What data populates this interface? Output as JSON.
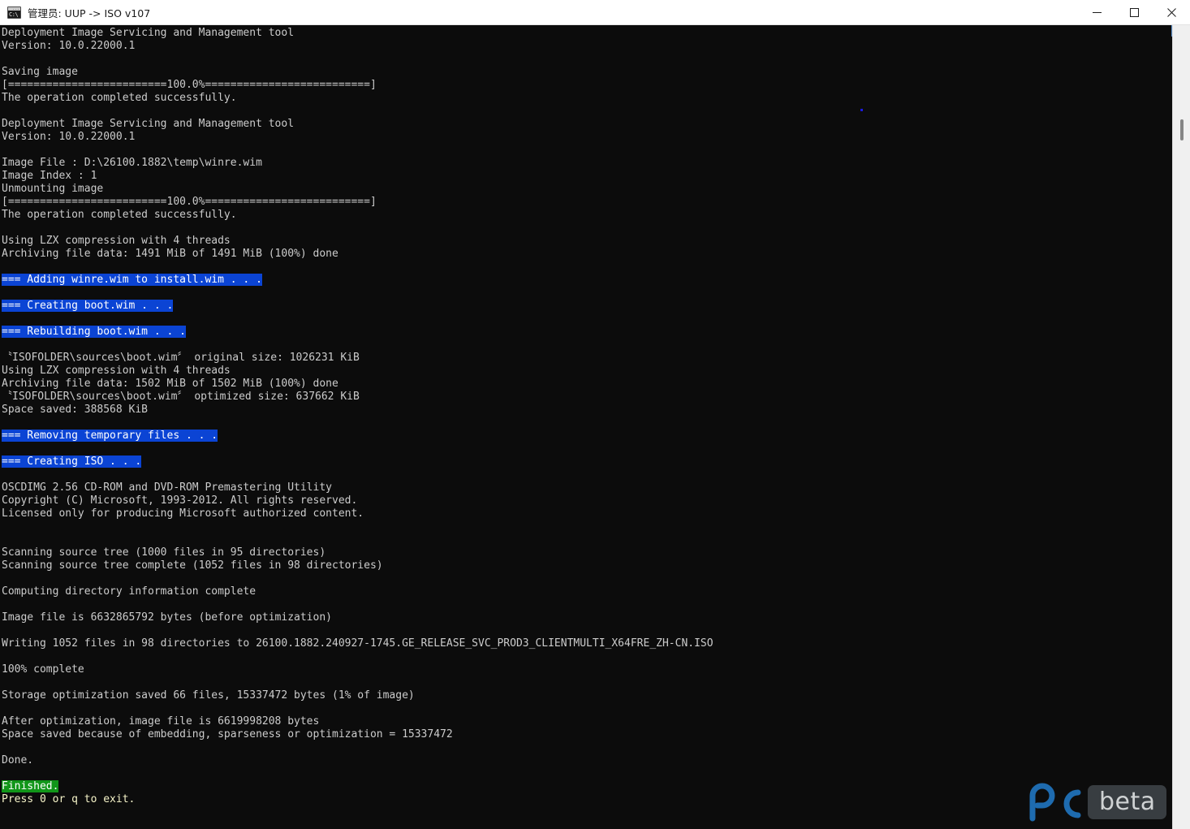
{
  "window": {
    "title": "管理员:  UUP -> ISO v107",
    "icon": "cmd-console-icon",
    "icon_prompt_text": "C:\\",
    "background_color": "#0c0c0c",
    "text_color": "#cccccc",
    "controls": {
      "minimize_label": "—",
      "maximize_label": "□",
      "close_label": "✕"
    }
  },
  "colors": {
    "highlight_blue_bg": "#0b44d4",
    "highlight_green_bg": "#119619",
    "highlight_text": "#ffffff",
    "prompt_yellow": "#f5f3c8",
    "titlebar_bg": "#ffffff",
    "scrollbar_track": "#f0f0f0",
    "scrollbar_thumb": "#858585",
    "watermark_blue": "#1f6fb5",
    "watermark_chip": "#3a3f43"
  },
  "console": {
    "lines": [
      {
        "text": "Deployment Image Servicing and Management tool",
        "style": "normal"
      },
      {
        "text": "Version: 10.0.22000.1",
        "style": "normal"
      },
      {
        "text": "",
        "style": "normal"
      },
      {
        "text": "Saving image",
        "style": "normal"
      },
      {
        "text": "[=========================100.0%==========================]",
        "style": "normal"
      },
      {
        "text": "The operation completed successfully.",
        "style": "normal"
      },
      {
        "text": "",
        "style": "normal"
      },
      {
        "text": "Deployment Image Servicing and Management tool",
        "style": "normal"
      },
      {
        "text": "Version: 10.0.22000.1",
        "style": "normal"
      },
      {
        "text": "",
        "style": "normal"
      },
      {
        "text": "Image File : D:\\26100.1882\\temp\\winre.wim",
        "style": "normal"
      },
      {
        "text": "Image Index : 1",
        "style": "normal"
      },
      {
        "text": "Unmounting image",
        "style": "normal"
      },
      {
        "text": "[=========================100.0%==========================]",
        "style": "normal"
      },
      {
        "text": "The operation completed successfully.",
        "style": "normal"
      },
      {
        "text": "",
        "style": "normal"
      },
      {
        "text": "Using LZX compression with 4 threads",
        "style": "normal"
      },
      {
        "text": "Archiving file data: 1491 MiB of 1491 MiB (100%) done",
        "style": "normal"
      },
      {
        "text": "",
        "style": "normal"
      },
      {
        "text": "=== Adding winre.wim to install.wim . . .",
        "style": "blue"
      },
      {
        "text": "",
        "style": "normal"
      },
      {
        "text": "=== Creating boot.wim . . .",
        "style": "blue"
      },
      {
        "text": "",
        "style": "normal"
      },
      {
        "text": "=== Rebuilding boot.wim . . .",
        "style": "blue"
      },
      {
        "text": "",
        "style": "normal"
      },
      {
        "text": "〝ISOFOLDER\\sources\\boot.wim〞 original size: 1026231 KiB",
        "style": "normal"
      },
      {
        "text": "Using LZX compression with 4 threads",
        "style": "normal"
      },
      {
        "text": "Archiving file data: 1502 MiB of 1502 MiB (100%) done",
        "style": "normal"
      },
      {
        "text": "〝ISOFOLDER\\sources\\boot.wim〞 optimized size: 637662 KiB",
        "style": "normal"
      },
      {
        "text": "Space saved: 388568 KiB",
        "style": "normal"
      },
      {
        "text": "",
        "style": "normal"
      },
      {
        "text": "=== Removing temporary files . . .",
        "style": "blue"
      },
      {
        "text": "",
        "style": "normal"
      },
      {
        "text": "=== Creating ISO . . .",
        "style": "blue"
      },
      {
        "text": "",
        "style": "normal"
      },
      {
        "text": "OSCDIMG 2.56 CD-ROM and DVD-ROM Premastering Utility",
        "style": "normal"
      },
      {
        "text": "Copyright (C) Microsoft, 1993-2012. All rights reserved.",
        "style": "normal"
      },
      {
        "text": "Licensed only for producing Microsoft authorized content.",
        "style": "normal"
      },
      {
        "text": "",
        "style": "normal"
      },
      {
        "text": "",
        "style": "normal"
      },
      {
        "text": "Scanning source tree (1000 files in 95 directories)",
        "style": "normal"
      },
      {
        "text": "Scanning source tree complete (1052 files in 98 directories)",
        "style": "normal"
      },
      {
        "text": "",
        "style": "normal"
      },
      {
        "text": "Computing directory information complete",
        "style": "normal"
      },
      {
        "text": "",
        "style": "normal"
      },
      {
        "text": "Image file is 6632865792 bytes (before optimization)",
        "style": "normal"
      },
      {
        "text": "",
        "style": "normal"
      },
      {
        "text": "Writing 1052 files in 98 directories to 26100.1882.240927-1745.GE_RELEASE_SVC_PROD3_CLIENTMULTI_X64FRE_ZH-CN.ISO",
        "style": "normal"
      },
      {
        "text": "",
        "style": "normal"
      },
      {
        "text": "100% complete",
        "style": "normal"
      },
      {
        "text": "",
        "style": "normal"
      },
      {
        "text": "Storage optimization saved 66 files, 15337472 bytes (1% of image)",
        "style": "normal"
      },
      {
        "text": "",
        "style": "normal"
      },
      {
        "text": "After optimization, image file is 6619998208 bytes",
        "style": "normal"
      },
      {
        "text": "Space saved because of embedding, sparseness or optimization = 15337472",
        "style": "normal"
      },
      {
        "text": "",
        "style": "normal"
      },
      {
        "text": "Done.",
        "style": "normal"
      },
      {
        "text": "",
        "style": "normal"
      },
      {
        "text": "Finished.",
        "style": "green"
      },
      {
        "text": "Press 0 or q to exit.",
        "style": "yellow"
      }
    ]
  },
  "scrollbar": {
    "orientation": "vertical",
    "thumb_position_percent": 12
  },
  "watermark": {
    "logo_text": "PC",
    "chip_text": "beta"
  }
}
